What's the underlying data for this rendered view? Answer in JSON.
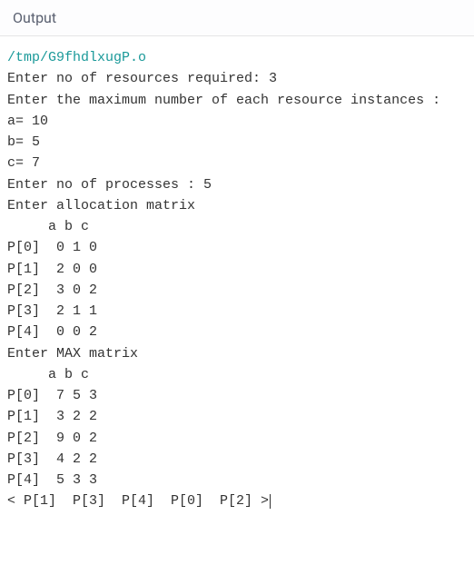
{
  "header": {
    "title": "Output"
  },
  "terminal": {
    "path": "/tmp/G9fhdlxugP.o",
    "lines": [
      "Enter no of resources required: 3",
      "Enter the maximum number of each resource instances :",
      "a= 10",
      "b= 5",
      "c= 7",
      "Enter no of processes : 5",
      "Enter allocation matrix",
      "     a b c",
      "P[0]  0 1 0",
      "P[1]  2 0 0",
      "P[2]  3 0 2",
      "P[3]  2 1 1",
      "P[4]  0 0 2",
      "Enter MAX matrix",
      "     a b c",
      "P[0]  7 5 3",
      "P[1]  3 2 2",
      "P[2]  9 0 2",
      "P[3]  4 2 2",
      "P[4]  5 3 3",
      "< P[1]  P[3]  P[4]  P[0]  P[2] >"
    ]
  }
}
